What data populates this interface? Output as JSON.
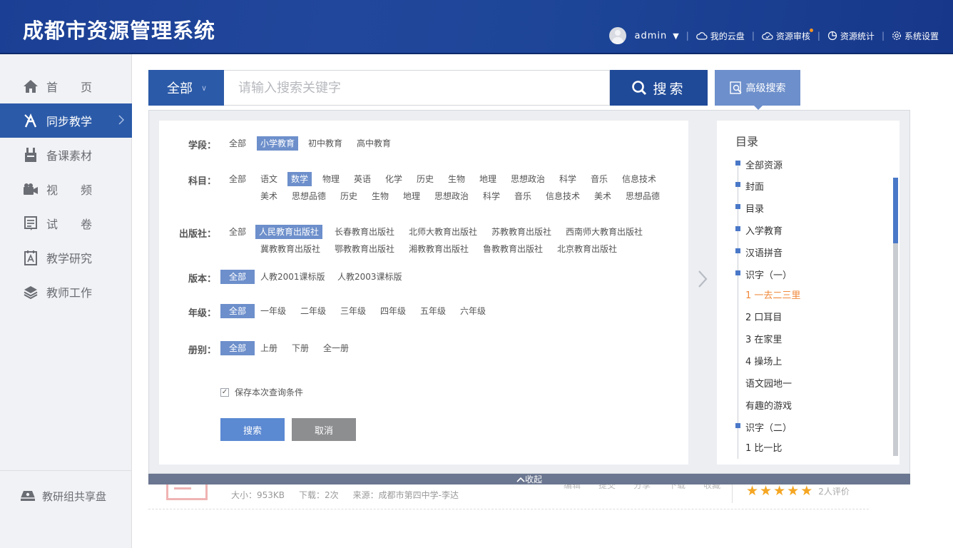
{
  "header": {
    "title": "成都市资源管理系统",
    "username": "admin",
    "nav": [
      {
        "label": "我的云盘",
        "icon": "cloud-icon"
      },
      {
        "label": "资源审核",
        "icon": "cloud-check-icon"
      },
      {
        "label": "资源统计",
        "icon": "chart-icon"
      },
      {
        "label": "系统设置",
        "icon": "gear-icon"
      }
    ]
  },
  "sidebar": {
    "items": [
      {
        "label": "首　　页",
        "icon": "home-icon"
      },
      {
        "label": "同步教学",
        "icon": "teaching-icon",
        "active": true
      },
      {
        "label": "备课素材",
        "icon": "materials-icon"
      },
      {
        "label": "视　　频",
        "icon": "video-icon"
      },
      {
        "label": "试　　卷",
        "icon": "exam-icon"
      },
      {
        "label": "教学研究",
        "icon": "research-icon"
      },
      {
        "label": "教师工作",
        "icon": "layers-icon"
      }
    ],
    "bottom": {
      "label": "教研组共享盘",
      "icon": "shared-disk-icon"
    }
  },
  "search": {
    "scope": "全部",
    "placeholder": "请输入搜索关键字",
    "button": "搜索",
    "advanced": "高级搜索"
  },
  "filters": {
    "stage": {
      "label": "学段：",
      "options": [
        "全部",
        "小学教育",
        "初中教育",
        "高中教育"
      ],
      "selected": "小学教育"
    },
    "subject": {
      "label": "科目：",
      "options": [
        "全部",
        "语文",
        "数学",
        "物理",
        "英语",
        "化学",
        "历史",
        "生物",
        "地理",
        "思想政治",
        "科学",
        "音乐",
        "信息技术",
        "美术",
        "思想品德",
        "历史",
        "生物",
        "地理",
        "思想政治",
        "科学",
        "音乐",
        "信息技术",
        "美术",
        "思想品德"
      ],
      "selected": "数学"
    },
    "publisher": {
      "label": "出版社：",
      "options": [
        "全部",
        "人民教育出版社",
        "长春教育出版社",
        "北师大教育出版社",
        "苏教教育出版社",
        "西南师大教育出版社",
        "冀教教育出版社",
        "鄂教教育出版社",
        "湘教教育出版社",
        "鲁教教育出版社",
        "北京教育出版社"
      ],
      "selected": "人民教育出版社"
    },
    "edition": {
      "label": "版本：",
      "options": [
        "全部",
        "人教2001课标版",
        "人教2003课标版"
      ],
      "selected": "全部"
    },
    "grade": {
      "label": "年级：",
      "options": [
        "全部",
        "一年级",
        "二年级",
        "三年级",
        "四年级",
        "五年级",
        "六年级"
      ],
      "selected": "全部"
    },
    "volume": {
      "label": "册别：",
      "options": [
        "全部",
        "上册",
        "下册",
        "全一册"
      ],
      "selected": "全部"
    },
    "save_label": "保存本次查询条件",
    "save_checked": true,
    "search_btn": "搜索",
    "cancel_btn": "取消"
  },
  "toc": {
    "title": "目录",
    "items": [
      {
        "label": "全部资源",
        "bullet": true
      },
      {
        "label": "封面",
        "bullet": true
      },
      {
        "label": "目录",
        "bullet": true
      },
      {
        "label": "入学教育",
        "bullet": true
      },
      {
        "label": "汉语拼音",
        "bullet": true
      },
      {
        "label": "识字（一）",
        "bullet": true
      },
      {
        "label": "1 一去二三里",
        "highlight": true
      },
      {
        "label": "2 口耳目"
      },
      {
        "label": "3 在家里"
      },
      {
        "label": "4 操场上"
      },
      {
        "label": "语文园地一"
      },
      {
        "label": "有趣的游戏"
      },
      {
        "label": "识字（二）",
        "bullet": true
      },
      {
        "label": "1 比一比"
      }
    ]
  },
  "collapse_label": "收起",
  "underlying_item": {
    "size": "大小：953KB",
    "downloads": "下载：2次",
    "source": "来源：成都市第四中学-李达",
    "actions": [
      "编辑",
      "提交",
      "分享",
      "下载",
      "收藏"
    ],
    "rating_stars": 5,
    "reviews": "2人评价"
  },
  "colors": {
    "brand": "#2b5aa8",
    "selected": "#6d8fcb",
    "highlight": "#f0883a",
    "star": "#f5a623"
  }
}
